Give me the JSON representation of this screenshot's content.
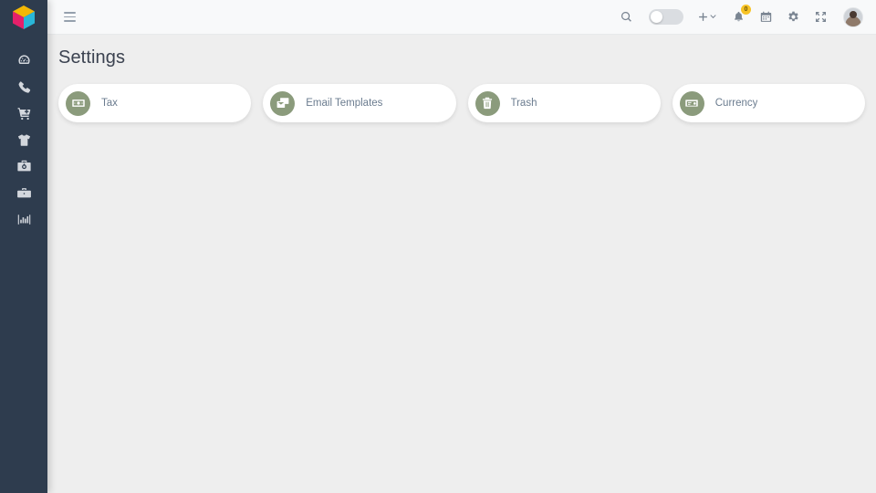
{
  "app": {
    "logo_icon": "cube-logo",
    "logo_colors": {
      "top": "#f2b705",
      "left": "#e5206a",
      "right": "#29b6d8"
    },
    "sidebar_bg": "#2e3c4e",
    "content_bg": "#eeeeee",
    "accent_green": "#8b9b7c",
    "badge_color": "#f7c325"
  },
  "sidebar": {
    "items": [
      {
        "name": "dashboard",
        "icon": "speedometer-icon"
      },
      {
        "name": "calls",
        "icon": "phone-icon"
      },
      {
        "name": "orders",
        "icon": "shopping-cart-icon"
      },
      {
        "name": "products",
        "icon": "tshirt-icon"
      },
      {
        "name": "inventory",
        "icon": "toolbox-icon"
      },
      {
        "name": "jobs",
        "icon": "briefcase-icon"
      },
      {
        "name": "reports",
        "icon": "bar-chart-icon"
      }
    ]
  },
  "topbar": {
    "menu_icon": "hamburger-icon",
    "search_icon": "search-icon",
    "toggle": {
      "name": "theme-toggle",
      "state": "off"
    },
    "add_icon": "plus-icon",
    "add_caret_icon": "chevron-down-icon",
    "notifications_icon": "bell-icon",
    "notifications_badge": "0",
    "calendar_icon": "calendar-icon",
    "settings_icon": "gear-icon",
    "fullscreen_icon": "expand-icon",
    "avatar_icon": "user-avatar"
  },
  "page": {
    "title": "Settings"
  },
  "cards": [
    {
      "label": "Tax",
      "icon": "banknote-icon"
    },
    {
      "label": "Email Templates",
      "icon": "email-templates-icon"
    },
    {
      "label": "Trash",
      "icon": "trash-icon"
    },
    {
      "label": "Currency",
      "icon": "currency-icon"
    }
  ]
}
